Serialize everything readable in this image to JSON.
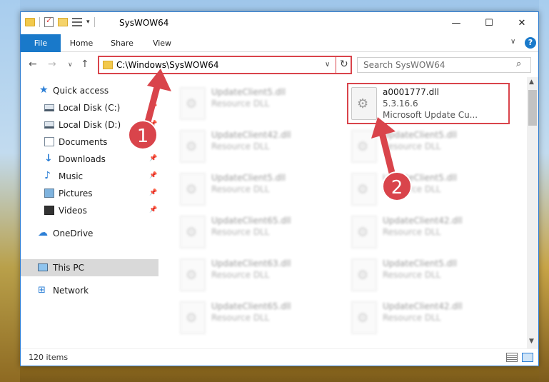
{
  "window": {
    "title": "SysWOW64",
    "controls": {
      "minimize": "—",
      "maximize": "☐",
      "close": "✕"
    }
  },
  "ribbon": {
    "tabs": [
      "File",
      "Home",
      "Share",
      "View"
    ],
    "collapse_glyph": "∨",
    "help_glyph": "?"
  },
  "nav": {
    "back_glyph": "←",
    "forward_glyph": "→",
    "recent_glyph": "∨",
    "up_glyph": "↑",
    "address": "C:\\Windows\\SysWOW64",
    "address_dropdown_glyph": "∨",
    "refresh_glyph": "↻",
    "search_placeholder": "Search SysWOW64",
    "search_glyph": "⌕"
  },
  "sidebar": {
    "items": [
      {
        "label": "Quick access",
        "icon": "star-icon"
      },
      {
        "label": "Local Disk (C:)",
        "icon": "drive-icon",
        "pinned": true
      },
      {
        "label": "Local Disk (D:)",
        "icon": "drive-icon",
        "pinned": true
      },
      {
        "label": "Documents",
        "icon": "documents-icon",
        "pinned": true
      },
      {
        "label": "Downloads",
        "icon": "downloads-icon",
        "pinned": true
      },
      {
        "label": "Music",
        "icon": "music-icon",
        "pinned": true
      },
      {
        "label": "Pictures",
        "icon": "pictures-icon",
        "pinned": true
      },
      {
        "label": "Videos",
        "icon": "videos-icon",
        "pinned": true
      },
      {
        "label": "OneDrive",
        "icon": "cloud-icon"
      },
      {
        "label": "This PC",
        "icon": "computer-icon",
        "selected": true
      },
      {
        "label": "Network",
        "icon": "network-icon"
      }
    ],
    "pin_glyph": "📌"
  },
  "files": {
    "left_column": [
      {
        "name": "UpdateClient5.dll",
        "type": "Resource DLL"
      },
      {
        "name": "UpdateClient42.dll",
        "type": "Resource DLL"
      },
      {
        "name": "UpdateClient5.dll",
        "type": "Resource DLL"
      },
      {
        "name": "UpdateClient65.dll",
        "type": "Resource DLL"
      },
      {
        "name": "UpdateClient63.dll",
        "type": "Resource DLL"
      },
      {
        "name": "UpdateClient65.dll",
        "type": "Resource DLL"
      }
    ],
    "right_column": [
      {
        "name": "a0001777.dll",
        "version": "5.3.16.6",
        "description": "Microsoft Update Cu..."
      },
      {
        "name": "UpdateClient5.dll",
        "type": "Resource DLL"
      },
      {
        "name": "UpdateClient5.dll",
        "type": "Resource DLL"
      },
      {
        "name": "UpdateClient42.dll",
        "type": "Resource DLL"
      },
      {
        "name": "UpdateClient5.dll",
        "type": "Resource DLL"
      },
      {
        "name": "UpdateClient42.dll",
        "type": "Resource DLL"
      }
    ]
  },
  "statusbar": {
    "item_count": "120 items"
  },
  "annotations": {
    "markers": [
      "1",
      "2"
    ],
    "highlight_color": "#d9444b"
  },
  "colors": {
    "accent": "#1979ca",
    "annotation_red": "#d9444b",
    "selected_bg": "#d9d9d9"
  }
}
